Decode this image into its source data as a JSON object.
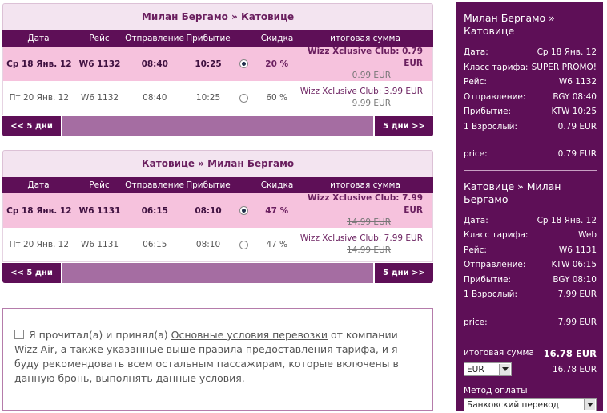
{
  "outbound": {
    "title": "Милан Бергамо » Катовице",
    "headers": [
      "Дата",
      "Рейс",
      "Отправление",
      "Прибытие",
      "Скидка",
      "итоговая сумма"
    ],
    "rows": [
      {
        "date": "Ср 18 Янв. 12",
        "flight": "W6 1132",
        "dep": "08:40",
        "arr": "10:25",
        "selected": true,
        "discount": "20 %",
        "price": "Wizz Xclusive Club: 0.79 EUR",
        "old_price": "0.99 EUR"
      },
      {
        "date": "Пт 20 Янв. 12",
        "flight": "W6 1132",
        "dep": "08:40",
        "arr": "10:25",
        "selected": false,
        "discount": "60 %",
        "price": "Wizz Xclusive Club: 3.99 EUR",
        "old_price": "9.99 EUR"
      }
    ],
    "prev": "<< 5 дни",
    "next": "5 дни >>"
  },
  "return": {
    "title": "Катовице » Милан Бергамо",
    "headers": [
      "Дата",
      "Рейс",
      "Отправление",
      "Прибытие",
      "Скидка",
      "итоговая сумма"
    ],
    "rows": [
      {
        "date": "Ср 18 Янв. 12",
        "flight": "W6 1131",
        "dep": "06:15",
        "arr": "08:10",
        "selected": true,
        "discount": "47 %",
        "price": "Wizz Xclusive Club: 7.99 EUR",
        "old_price": "14.99 EUR"
      },
      {
        "date": "Пт 20 Янв. 12",
        "flight": "W6 1131",
        "dep": "06:15",
        "arr": "08:10",
        "selected": false,
        "discount": "47 %",
        "price": "Wizz Xclusive Club: 7.99 EUR",
        "old_price": "14.99 EUR"
      }
    ],
    "prev": "<< 5 дни",
    "next": "5 дни >>"
  },
  "terms": {
    "before": "Я прочитал(а) и принял(а) ",
    "link": "Основные условия перевозки",
    "after": " от компании Wizz Air, а также указанные выше правила предоставления тарифа, и я буду рекомендовать всем остальным пассажирам, которые включены в данную бронь, выполнять данные условия."
  },
  "summary": {
    "out": {
      "title": "Милан Бергамо » Катовице",
      "items": [
        {
          "k": "Дата:",
          "v": "Ср 18 Янв. 12"
        },
        {
          "k": "Класс тарифа:",
          "v": "SUPER PROMO!"
        },
        {
          "k": "Рейс:",
          "v": "W6 1132"
        },
        {
          "k": "Отправление:",
          "v": "BGY 08:40"
        },
        {
          "k": "Прибытие:",
          "v": "KTW 10:25"
        },
        {
          "k": "1 Взрослый:",
          "v": "0.79 EUR"
        }
      ],
      "price_label": "price:",
      "price": "0.79 EUR"
    },
    "ret": {
      "title": "Катовице » Милан Бергамо",
      "items": [
        {
          "k": "Дата:",
          "v": "Ср 18 Янв. 12"
        },
        {
          "k": "Класс тарифа:",
          "v": "Web"
        },
        {
          "k": "Рейс:",
          "v": "W6 1131"
        },
        {
          "k": "Отправление:",
          "v": "KTW 06:15"
        },
        {
          "k": "Прибытие:",
          "v": "BGY 08:10"
        },
        {
          "k": "1 Взрослый:",
          "v": "7.99 EUR"
        }
      ],
      "price_label": "price:",
      "price": "7.99 EUR"
    },
    "total_label": "итоговая сумма",
    "total": "16.78 EUR",
    "currency": "EUR",
    "total_converted": "16.78 EUR",
    "payment_label": "Метод оплаты",
    "payment_method": "Банковский перевод"
  },
  "colors": {
    "brand": "#5e0f57",
    "selected_row": "#f6c2dd",
    "pager_mid": "#a56da2"
  }
}
